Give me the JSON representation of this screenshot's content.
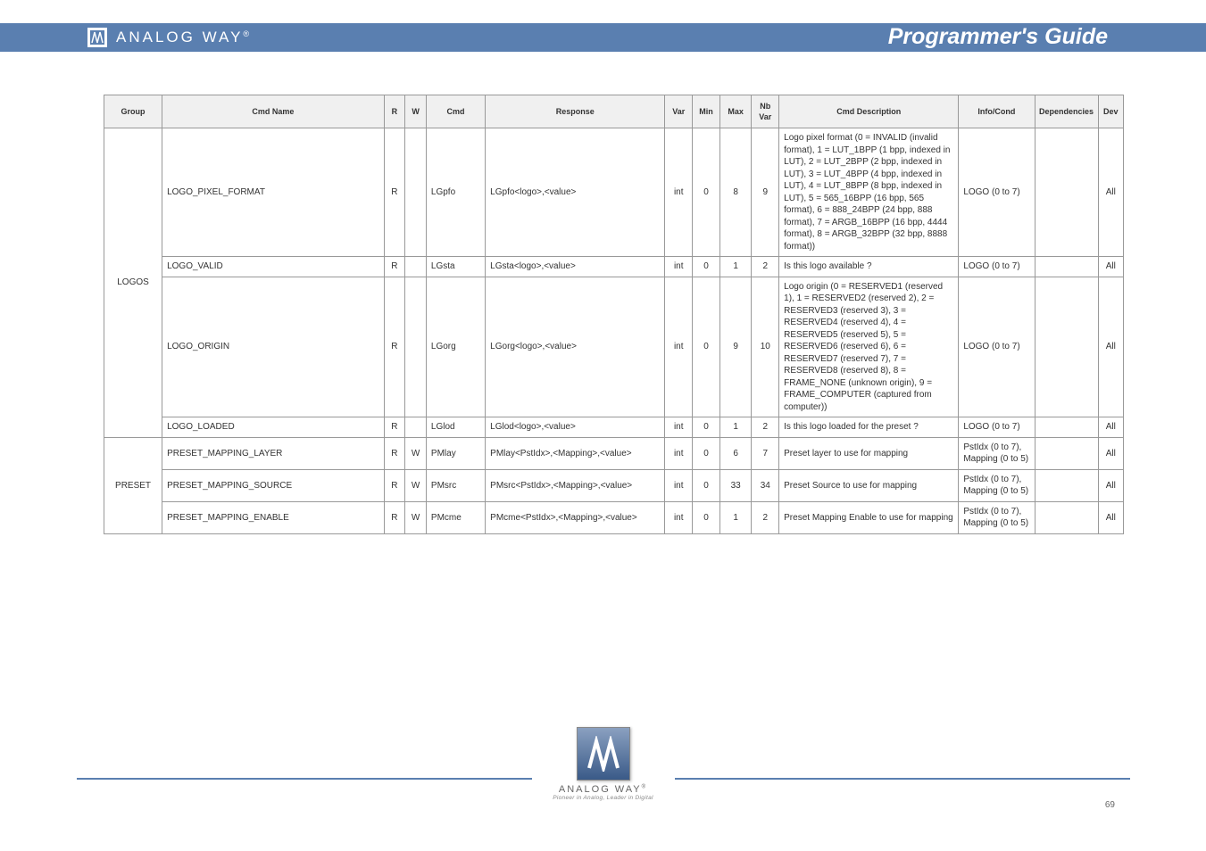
{
  "header": {
    "brand": "ANALOG WAY",
    "reg": "®",
    "title": "Programmer's Guide"
  },
  "table": {
    "headers": [
      "Group",
      "Cmd Name",
      "R",
      "W",
      "Cmd",
      "Response",
      "Var",
      "Min",
      "Max",
      "Nb Var",
      "Cmd Description",
      "Info/Cond",
      "Dependencies",
      "Dev"
    ],
    "rows": [
      {
        "group": "LOGOS",
        "group_rowspan": 4,
        "name": "LOGO_PIXEL_FORMAT",
        "r": "R",
        "w": "",
        "cmd": "LGpfo",
        "rsp": "LGpfo<logo>,<value>",
        "var": "int",
        "min": "0",
        "max": "8",
        "nbv": "9",
        "desc": "Logo pixel format (0 = INVALID (invalid format), 1 = LUT_1BPP (1 bpp, indexed in LUT), 2 = LUT_2BPP (2 bpp, indexed in LUT), 3 = LUT_4BPP (4 bpp, indexed in LUT), 4 = LUT_8BPP (8 bpp, indexed in LUT), 5 = 565_16BPP (16 bpp, 565 format), 6 = 888_24BPP (24 bpp, 888 format), 7 = ARGB_16BPP (16 bpp, 4444 format), 8 = ARGB_32BPP (32 bpp, 8888 format))",
        "info": "LOGO (0 to 7)",
        "dep": "",
        "dev": "All"
      },
      {
        "name": "LOGO_VALID",
        "r": "R",
        "w": "",
        "cmd": "LGsta",
        "rsp": "LGsta<logo>,<value>",
        "var": "int",
        "min": "0",
        "max": "1",
        "nbv": "2",
        "desc": "Is this logo available ?",
        "info": "LOGO (0 to 7)",
        "dep": "",
        "dev": "All"
      },
      {
        "name": "LOGO_ORIGIN",
        "r": "R",
        "w": "",
        "cmd": "LGorg",
        "rsp": "LGorg<logo>,<value>",
        "var": "int",
        "min": "0",
        "max": "9",
        "nbv": "10",
        "desc": "Logo origin (0 = RESERVED1 (reserved 1), 1 = RESERVED2 (reserved 2), 2 = RESERVED3 (reserved 3), 3 = RESERVED4 (reserved 4), 4 = RESERVED5 (reserved 5), 5 = RESERVED6 (reserved 6), 6 = RESERVED7 (reserved 7), 7 = RESERVED8 (reserved 8), 8 = FRAME_NONE (unknown origin), 9 = FRAME_COMPUTER (captured from computer))",
        "info": "LOGO (0 to 7)",
        "dep": "",
        "dev": "All"
      },
      {
        "name": "LOGO_LOADED",
        "r": "R",
        "w": "",
        "cmd": "LGlod",
        "rsp": "LGlod<logo>,<value>",
        "var": "int",
        "min": "0",
        "max": "1",
        "nbv": "2",
        "desc": "Is this logo loaded for the preset ?",
        "info": "LOGO (0 to 7)",
        "dep": "",
        "dev": "All"
      },
      {
        "group": "PRESET",
        "group_rowspan": 3,
        "name": "PRESET_MAPPING_LAYER",
        "r": "R",
        "w": "W",
        "cmd": "PMlay",
        "rsp": "PMlay<PstIdx>,<Mapping>,<value>",
        "var": "int",
        "min": "0",
        "max": "6",
        "nbv": "7",
        "desc": "Preset layer to use for mapping",
        "info": "PstIdx (0 to 7), Mapping (0 to 5)",
        "dep": "",
        "dev": "All"
      },
      {
        "name": "PRESET_MAPPING_SOURCE",
        "r": "R",
        "w": "W",
        "cmd": "PMsrc",
        "rsp": "PMsrc<PstIdx>,<Mapping>,<value>",
        "var": "int",
        "min": "0",
        "max": "33",
        "nbv": "34",
        "desc": "Preset Source to use for mapping",
        "info": "PstIdx (0 to 7), Mapping (0 to 5)",
        "dep": "",
        "dev": "All"
      },
      {
        "name": "PRESET_MAPPING_ENABLE",
        "r": "R",
        "w": "W",
        "cmd": "PMcme",
        "rsp": "PMcme<PstIdx>,<Mapping>,<value>",
        "var": "int",
        "min": "0",
        "max": "1",
        "nbv": "2",
        "desc": "Preset Mapping Enable to use for mapping",
        "info": "PstIdx (0 to 7), Mapping (0 to 5)",
        "dep": "",
        "dev": "All"
      }
    ]
  },
  "footer": {
    "brand": "ANALOG WAY",
    "reg": "®",
    "tagline": "Pioneer in Analog, Leader in Digital"
  },
  "page": "69"
}
